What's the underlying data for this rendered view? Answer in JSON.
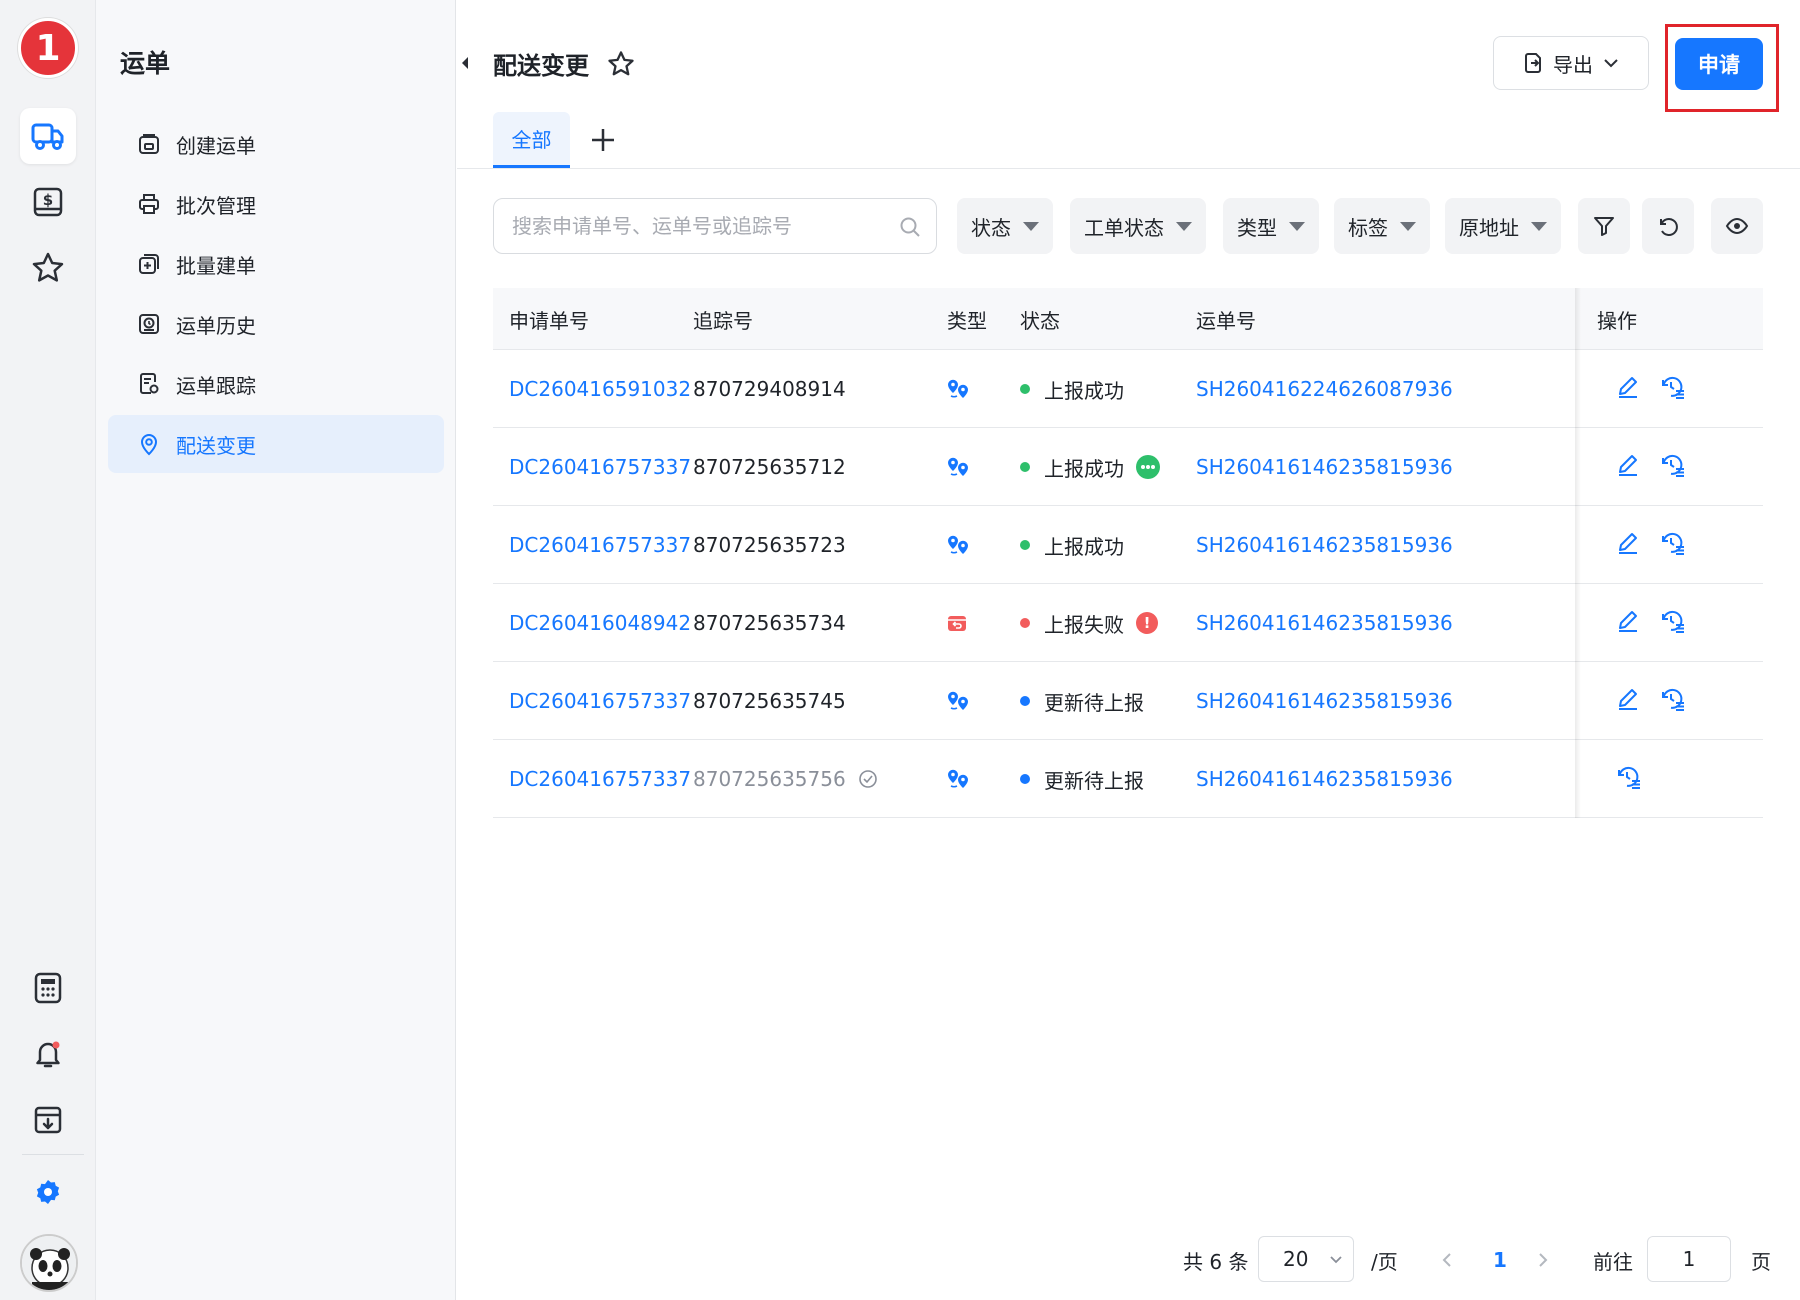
{
  "rail": {
    "logo_text": "1",
    "icons": [
      "truck-icon",
      "dollar-bill-icon",
      "star-icon",
      "calculator-icon",
      "bell-icon",
      "download-box-icon",
      "gear-icon"
    ]
  },
  "nav": {
    "title": "运单",
    "items": [
      {
        "label": "创建运单",
        "icon": "create-waybill-icon"
      },
      {
        "label": "批次管理",
        "icon": "printer-icon"
      },
      {
        "label": "批量建单",
        "icon": "batch-add-icon"
      },
      {
        "label": "运单历史",
        "icon": "history-icon"
      },
      {
        "label": "运单跟踪",
        "icon": "tracking-icon"
      },
      {
        "label": "配送变更",
        "icon": "location-pin-icon"
      }
    ]
  },
  "header": {
    "title": "配送变更",
    "export_label": "导出",
    "apply_label": "申请"
  },
  "tabs": {
    "all": "全部"
  },
  "search": {
    "placeholder": "搜索申请单号、运单号或追踪号"
  },
  "filters": [
    "状态",
    "工单状态",
    "类型",
    "标签",
    "原地址"
  ],
  "table": {
    "columns": [
      "申请单号",
      "追踪号",
      "类型",
      "状态",
      "运单号",
      "操作"
    ],
    "rows": [
      {
        "apply_no": "DC260416591032",
        "tracking": "870729408914",
        "type": "address-change",
        "status": "上报成功",
        "status_color": "#2ebf6b",
        "badge": "",
        "waybill": "SH260416224626087936",
        "ops": [
          "edit",
          "history"
        ]
      },
      {
        "apply_no": "DC260416757337",
        "tracking": "870725635712",
        "type": "address-change",
        "status": "上报成功",
        "status_color": "#2ebf6b",
        "badge": "more",
        "waybill": "SH260416146235815936",
        "ops": [
          "edit",
          "history"
        ]
      },
      {
        "apply_no": "DC260416757337",
        "tracking": "870725635723",
        "type": "address-change",
        "status": "上报成功",
        "status_color": "#2ebf6b",
        "badge": "",
        "waybill": "SH260416146235815936",
        "ops": [
          "edit",
          "history"
        ]
      },
      {
        "apply_no": "DC260416048942",
        "tracking": "870725635734",
        "type": "return",
        "status": "上报失败",
        "status_color": "#f25c5c",
        "badge": "error",
        "waybill": "SH260416146235815936",
        "ops": [
          "edit",
          "history"
        ]
      },
      {
        "apply_no": "DC260416757337",
        "tracking": "870725635745",
        "type": "address-change",
        "status": "更新待上报",
        "status_color": "#1677ff",
        "badge": "",
        "waybill": "SH260416146235815936",
        "ops": [
          "edit",
          "history"
        ]
      },
      {
        "apply_no": "DC260416757337",
        "tracking": "870725635756",
        "type": "address-change",
        "status": "更新待上报",
        "status_color": "#1677ff",
        "badge": "",
        "waybill": "SH260416146235815936",
        "ops": [
          "history"
        ],
        "tracking_muted": true,
        "tracking_check": true
      }
    ]
  },
  "pagination": {
    "total": "共 6 条",
    "page_size": "20",
    "per_page": "/页",
    "current": "1",
    "goto_label": "前往",
    "goto_value": "1",
    "page_suffix": "页"
  },
  "colors": {
    "accent": "#1677ff",
    "success": "#2ebf6b",
    "error": "#f25c5c",
    "highlight": "#e0242a"
  }
}
